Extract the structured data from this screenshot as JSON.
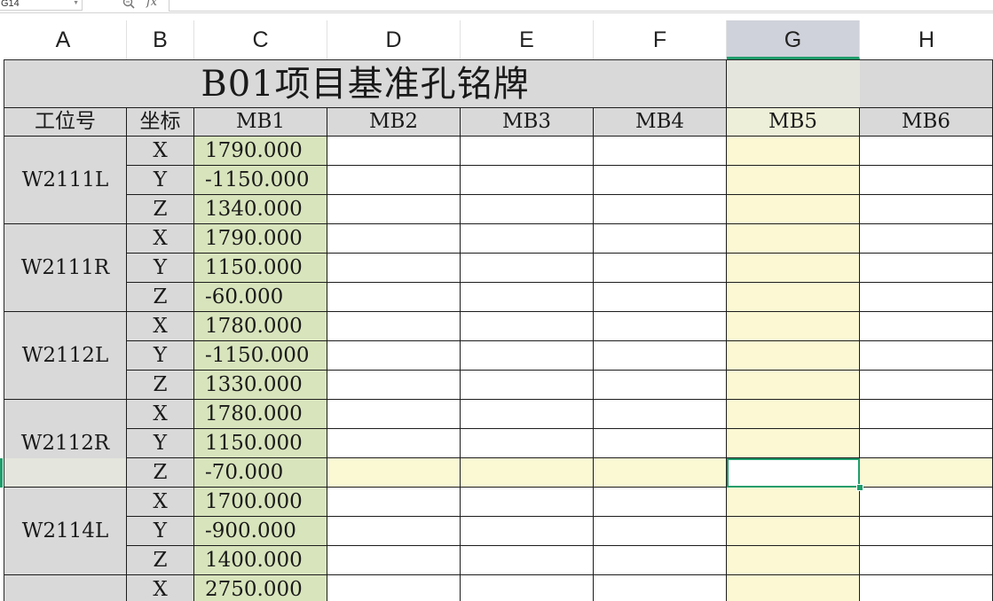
{
  "formula_bar": {
    "name_box": "G14",
    "fx_label": "fx",
    "formula": ""
  },
  "columns": [
    "A",
    "B",
    "C",
    "D",
    "E",
    "F",
    "G",
    "H"
  ],
  "selected_column": "G",
  "sheet": {
    "title": "B01项目基准孔铭牌",
    "headers": [
      "工位号",
      "坐标",
      "MB1",
      "MB2",
      "MB3",
      "MB4",
      "MB5",
      "MB6"
    ],
    "stations": [
      {
        "name": "W2111L",
        "rows": [
          {
            "axis": "X",
            "mb1": "1790.000"
          },
          {
            "axis": "Y",
            "mb1": "-1150.000"
          },
          {
            "axis": "Z",
            "mb1": "1340.000"
          }
        ]
      },
      {
        "name": "W2111R",
        "rows": [
          {
            "axis": "X",
            "mb1": "1790.000"
          },
          {
            "axis": "Y",
            "mb1": "1150.000"
          },
          {
            "axis": "Z",
            "mb1": "-60.000"
          }
        ]
      },
      {
        "name": "W2112L",
        "rows": [
          {
            "axis": "X",
            "mb1": "1780.000"
          },
          {
            "axis": "Y",
            "mb1": "-1150.000"
          },
          {
            "axis": "Z",
            "mb1": "1330.000"
          }
        ]
      },
      {
        "name": "W2112R",
        "rows": [
          {
            "axis": "X",
            "mb1": "1780.000"
          },
          {
            "axis": "Y",
            "mb1": "1150.000"
          },
          {
            "axis": "Z",
            "mb1": "-70.000"
          }
        ]
      },
      {
        "name": "W2114L",
        "rows": [
          {
            "axis": "X",
            "mb1": "1700.000"
          },
          {
            "axis": "Y",
            "mb1": "-900.000"
          },
          {
            "axis": "Z",
            "mb1": "1400.000"
          }
        ]
      },
      {
        "name": "",
        "rows": [
          {
            "axis": "X",
            "mb1": "2750.000"
          }
        ]
      }
    ]
  },
  "colors": {
    "accent": "#1f9d6b",
    "header_gray": "#d9d9d9",
    "mb1_green": "#d8e4bc",
    "highlight_yellow": "#fbf8d3"
  }
}
